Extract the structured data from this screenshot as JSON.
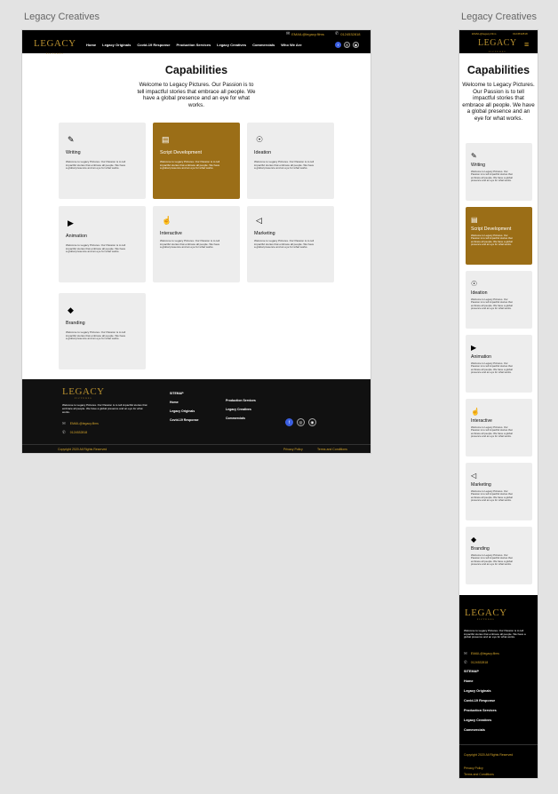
{
  "artboards": {
    "desktop_label": "Legacy Creatives",
    "mobile_label": "Legacy Creatives"
  },
  "topbar": {
    "email": "EMAIL@legacy.films",
    "phone": "0124532818"
  },
  "brand": {
    "logo_text": "LEGACY",
    "logo_sub": "PICTURES"
  },
  "nav": {
    "items": [
      "Home",
      "Legacy Originals",
      "Covid-19 Response",
      "Production Services",
      "Legacy Creatives",
      "Commercials",
      "Who We Are"
    ]
  },
  "social": [
    "f",
    "◎",
    "◉"
  ],
  "capabilities": {
    "title": "Capabilities",
    "intro": "Welcome to Legacy Pictures. Our Passion is to tell impactful stories that embrace all people. We have a global presence and an eye for what works.",
    "card_text": "Welcome to Legacy Pictures. Our Passion is to tell impactful stories that embrace all people. We have a global presence and an eye for what works.",
    "cards": [
      {
        "title": "Writing",
        "icon": "pen-icon",
        "glyph": "✎"
      },
      {
        "title": "Script Development",
        "icon": "document-icon",
        "glyph": "▤"
      },
      {
        "title": "Ideation",
        "icon": "lightbulb-icon",
        "glyph": "☉"
      },
      {
        "title": "Animation",
        "icon": "video-camera-icon",
        "glyph": "▶"
      },
      {
        "title": "Interactive",
        "icon": "cursor-click-icon",
        "glyph": "☝"
      },
      {
        "title": "Marketing",
        "icon": "megaphone-icon",
        "glyph": "◁"
      },
      {
        "title": "Branding",
        "icon": "tag-icon",
        "glyph": "◆"
      }
    ]
  },
  "footer": {
    "about": "Welcome to Legacy Pictures. Our Passion is to tell impactful stories that embrace all people. We have a global presence and an eye for what works.",
    "email": "EMAIL@legacy.films",
    "phone": "0124532818",
    "sitemap_title": "SITEMAP",
    "col1": [
      "Home",
      "Legacy Originals",
      "Covid-19 Response"
    ],
    "col2": [
      "Production Services",
      "Legacy Creatives",
      "Commercials"
    ],
    "mobile_links": [
      "Home",
      "Legacy Originals",
      "Covid-19 Response",
      "Production Services",
      "Legacy Creatives",
      "Commercials"
    ],
    "copyright": "Copyright 2020 All Rights Reserved",
    "privacy": "Privacy Policy",
    "terms": "Terms and Conditions"
  },
  "colors": {
    "accent": "#9b6e17",
    "gold": "#d4a52b",
    "dark": "#111111"
  }
}
